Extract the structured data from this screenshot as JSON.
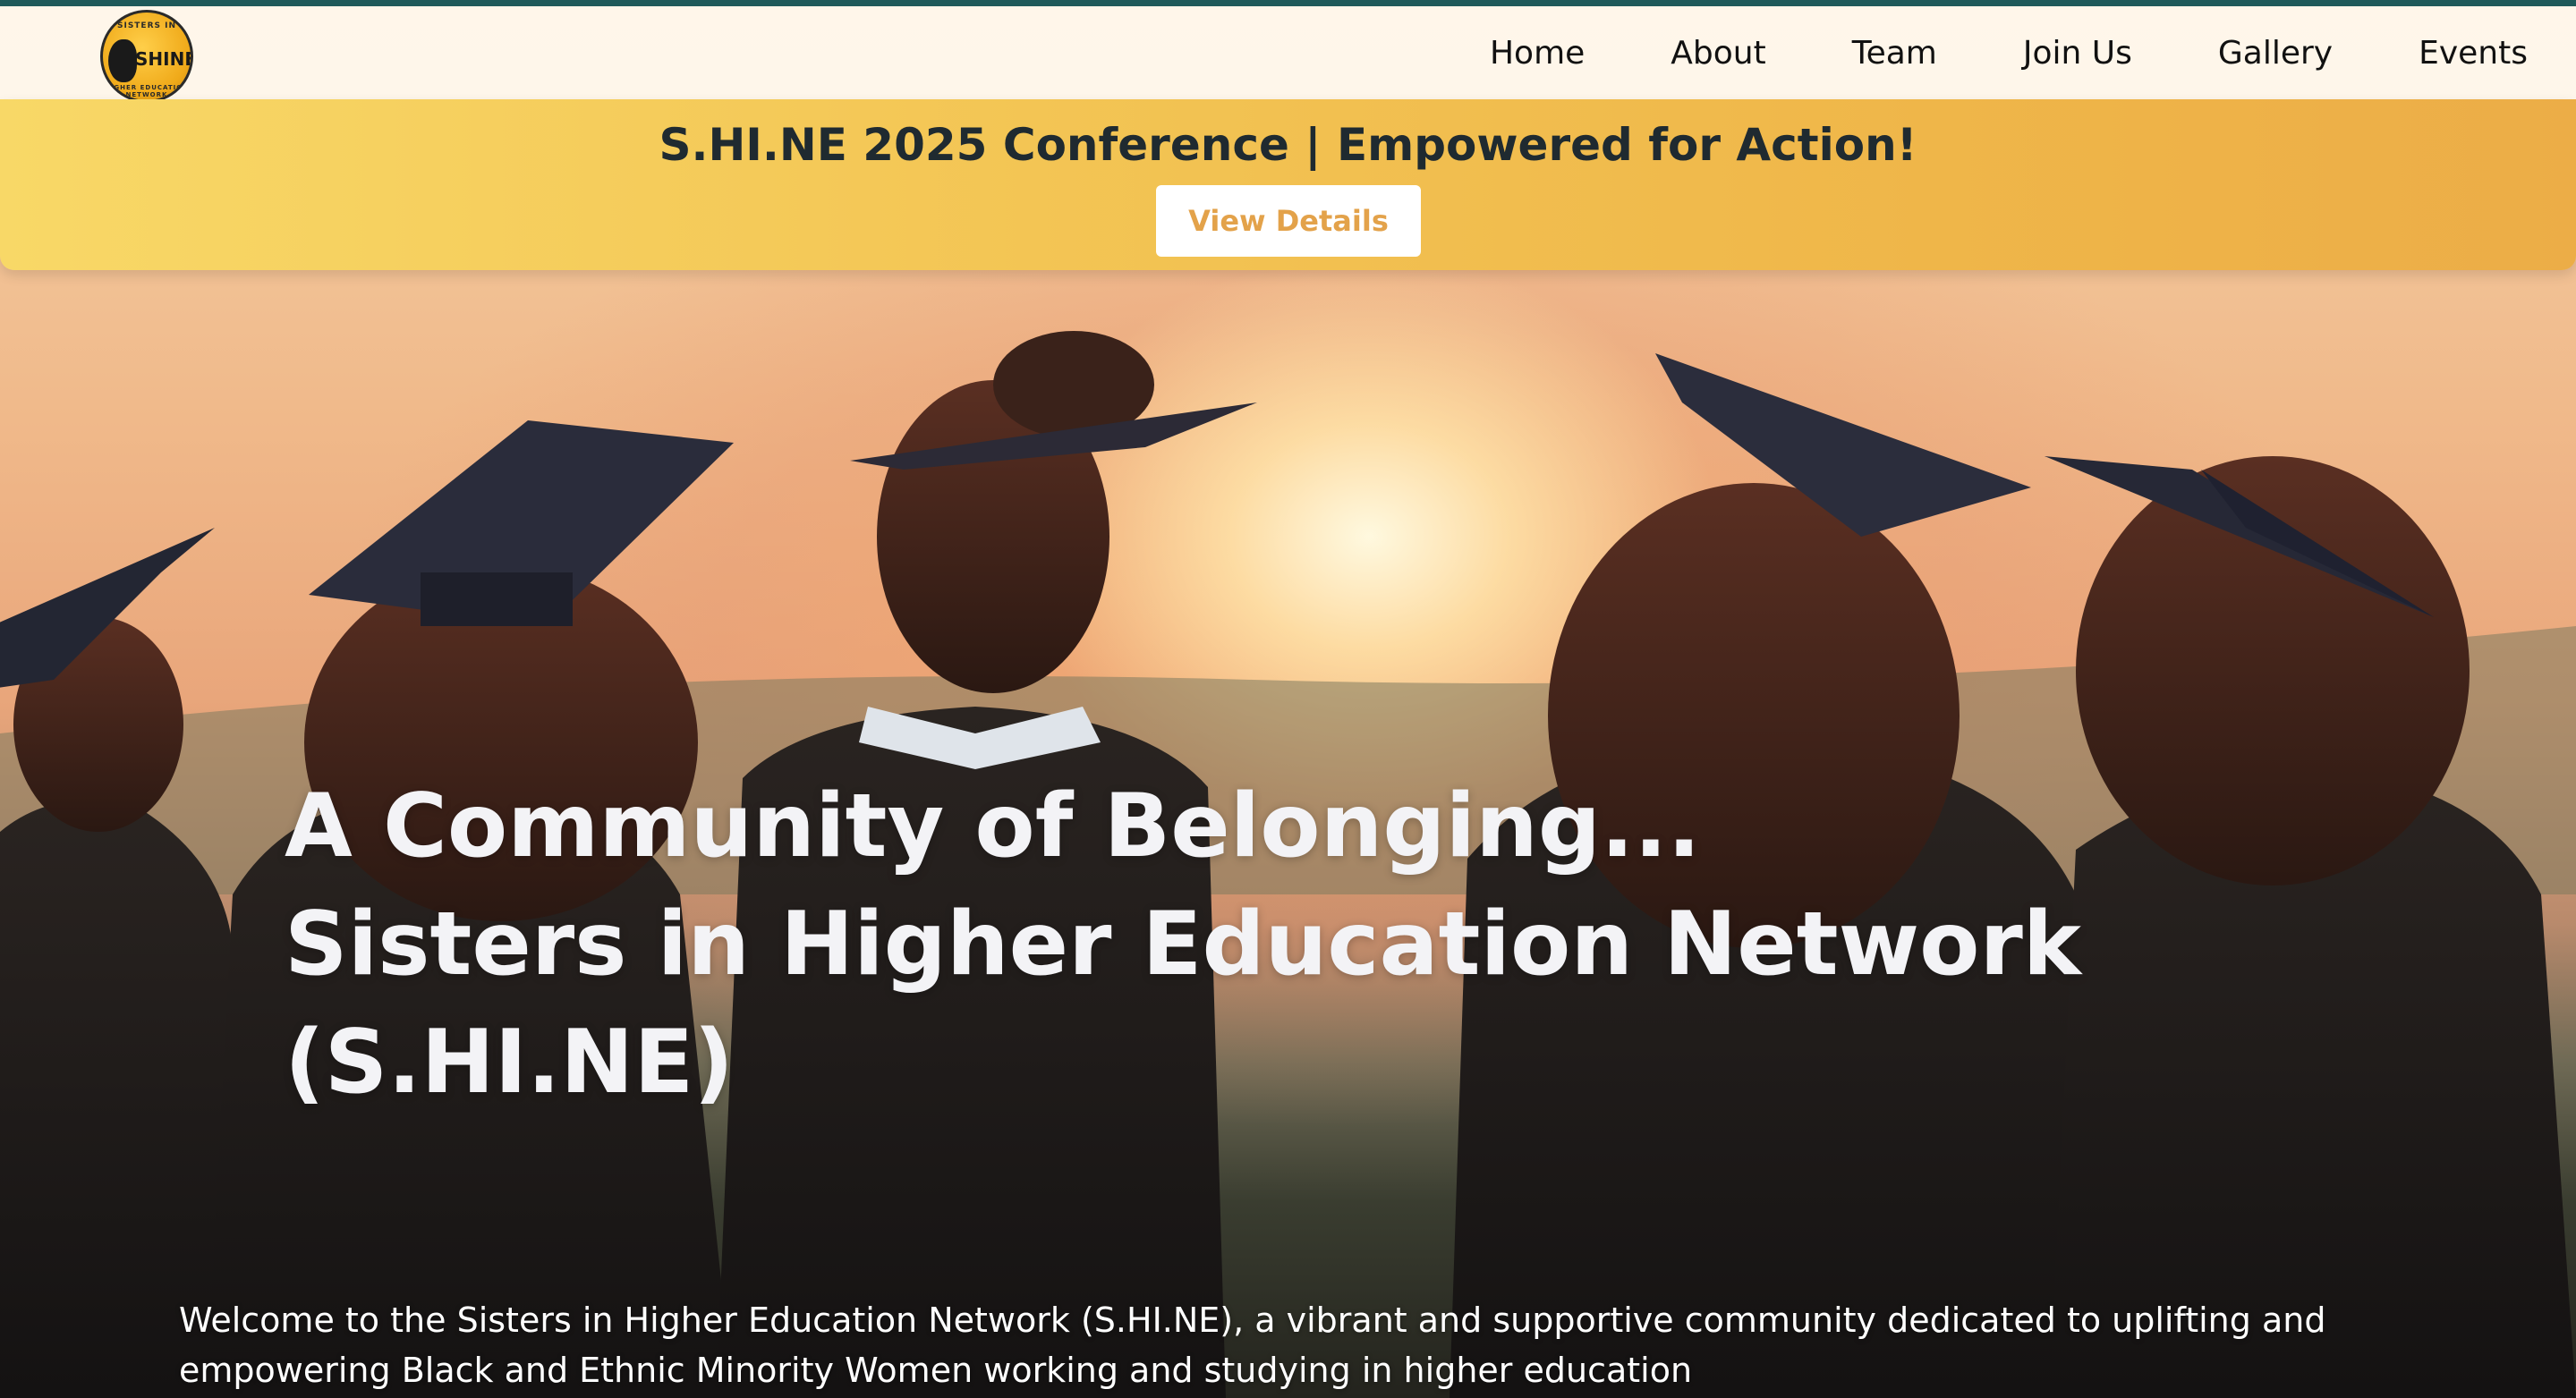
{
  "logo": {
    "name": "SHINE",
    "top_text": "SISTERS IN",
    "bottom_text": "HIGHER EDUCATION NETWORK"
  },
  "nav": {
    "items": [
      {
        "label": "Home"
      },
      {
        "label": "About"
      },
      {
        "label": "Team"
      },
      {
        "label": "Join Us"
      },
      {
        "label": "Gallery"
      },
      {
        "label": "Events"
      }
    ]
  },
  "banner": {
    "title": "S.HI.NE 2025 Conference | Empowered for Action!",
    "button_label": "View Details"
  },
  "hero": {
    "heading_line1": "A Community of Belonging...",
    "heading_line2": "Sisters in Higher Education Network",
    "heading_line3": "(S.HI.NE)",
    "intro": "Welcome to the Sisters in Higher Education Network (S.HI.NE), a vibrant and supportive community dedicated to uplifting and empowering Black and Ethnic Minority Women working and studying in higher education"
  },
  "colors": {
    "top_accent": "#1f5a5a",
    "banner_start": "#f8d867",
    "banner_end": "#ecad47",
    "banner_button_text": "#e3a24a",
    "heading_text": "#f3f3f6"
  },
  "icons": {
    "logo": "shine-logo-icon"
  }
}
